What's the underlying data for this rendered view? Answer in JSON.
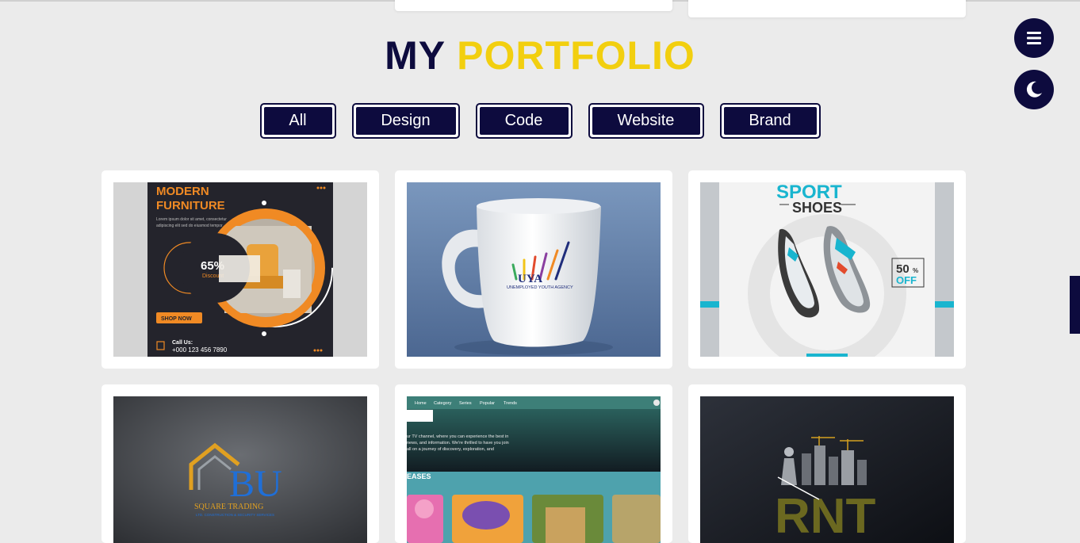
{
  "portfolio": {
    "title_part1": "MY",
    "title_part2": "PORTFOLIO"
  },
  "filters": [
    "All",
    "Design",
    "Code",
    "Website",
    "Brand"
  ],
  "controls": {
    "menu_icon": "hamburger-icon",
    "theme_icon": "moon-icon"
  },
  "items": [
    {
      "name": "modern-furniture-flyer",
      "heading_line1": "MODERN",
      "heading_line2": "FURNITURE",
      "tagline_line1": "Lorem ipsum dolor sit amet, consectetur",
      "tagline_line2": "adipiscing elit sed do eiusmod tempor",
      "discount": "65%",
      "discount_label": "Discount",
      "cta": "SHOP NOW",
      "call_label": "Call Us:",
      "phone": "+000 123 456 7890"
    },
    {
      "name": "uya-mug-mockup",
      "logo_text": "UYA",
      "logo_subtext": "UNEMPLOYED YOUTH AGENCY"
    },
    {
      "name": "sport-shoes-flyer",
      "heading_line1": "SPORT",
      "heading_line2": "SHOES",
      "badge_number": "50",
      "badge_percent": "%",
      "badge_label": "OFF"
    },
    {
      "name": "bu-square-trading-logo",
      "logo_text": "BU",
      "logo_subtext": "SQUARE TRADING",
      "logo_tagline": "LTD. CONSTRUCTION & SECURITY SERVICES"
    },
    {
      "name": "streaming-website-screenshot",
      "nav": [
        "Home",
        "Category",
        "Series",
        "Popular",
        "Trends"
      ],
      "intro_line1": "ur TV channel, where you can experience the best in",
      "intro_line2": "news, and information. We're thrilled to have you join",
      "intro_line3": "all on a journey of discovery, exploration, and",
      "section_heading": "EASES"
    },
    {
      "name": "rnt-construction-logo",
      "logo_text": "RNT"
    }
  ],
  "colors": {
    "navy": "#0d0b3e",
    "yellow": "#f2cf0f",
    "background": "#ebebeb",
    "orange": "#f08a24"
  }
}
